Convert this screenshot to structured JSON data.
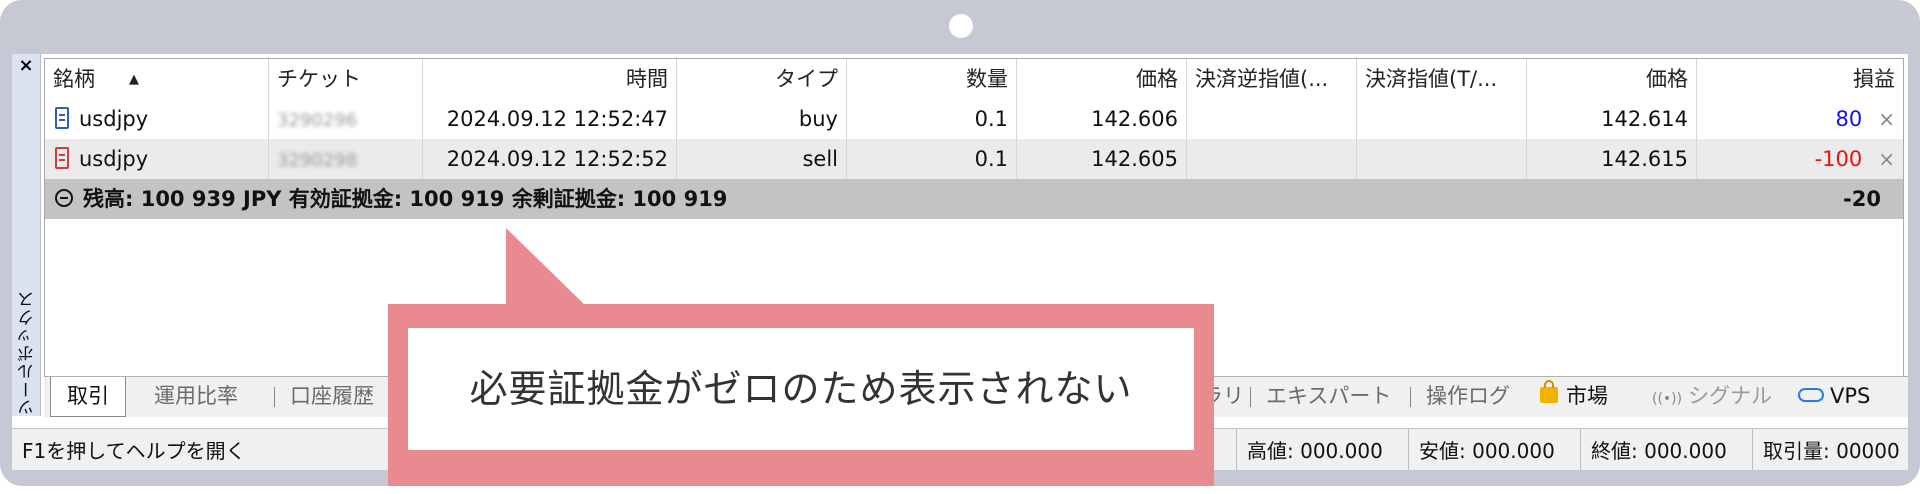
{
  "toolbox": {
    "close": "×",
    "title": "ツールボックス"
  },
  "columns": [
    "銘柄",
    "チケット",
    "時間",
    "タイプ",
    "数量",
    "価格",
    "決済逆指値(...",
    "決済指値(T/...",
    "価格",
    "損益"
  ],
  "sort_indicator": "▲",
  "rows": [
    {
      "type_icon": "buy-order-icon",
      "symbol": "usdjpy",
      "ticket": "3290296",
      "time": "2024.09.12 12:52:47",
      "type": "buy",
      "volume": "0.1",
      "price": "142.606",
      "sl": "",
      "tp": "",
      "cur_price": "142.614",
      "profit": "80",
      "profit_color": "#1010ee",
      "close_icon": "×"
    },
    {
      "type_icon": "sell-order-icon",
      "symbol": "usdjpy",
      "ticket": "3290298",
      "time": "2024.09.12 12:52:52",
      "type": "sell",
      "volume": "0.1",
      "price": "142.605",
      "sl": "",
      "tp": "",
      "cur_price": "142.615",
      "profit": "-100",
      "profit_color": "#ee1010",
      "close_icon": "×"
    }
  ],
  "summary": {
    "text": "残高: 100 939 JPY  有効証拠金: 100 919  余剰証拠金: 100 919",
    "total": "-20"
  },
  "tabs": {
    "trade": "取引",
    "exposure": "運用比率",
    "history": "口座履歴",
    "library": "ラリ",
    "experts": "エキスパート",
    "journal": "操作ログ",
    "market": "市場",
    "signals": "シグナル",
    "vps": "VPS"
  },
  "status": {
    "help": "F1を押してヘルプを開く",
    "high": "高値: 000.000",
    "low": "安値: 000.000",
    "close": "終値: 000.000",
    "volume": "取引量: 00000"
  },
  "callout": {
    "text": "必要証拠金がゼロのため表示されない",
    "color": "#e88a90"
  },
  "colors": {
    "frame": "#c6c8d4",
    "summary_bg": "#c3c3c3",
    "buy": "#2b5fb8",
    "sell": "#d43c3c"
  }
}
